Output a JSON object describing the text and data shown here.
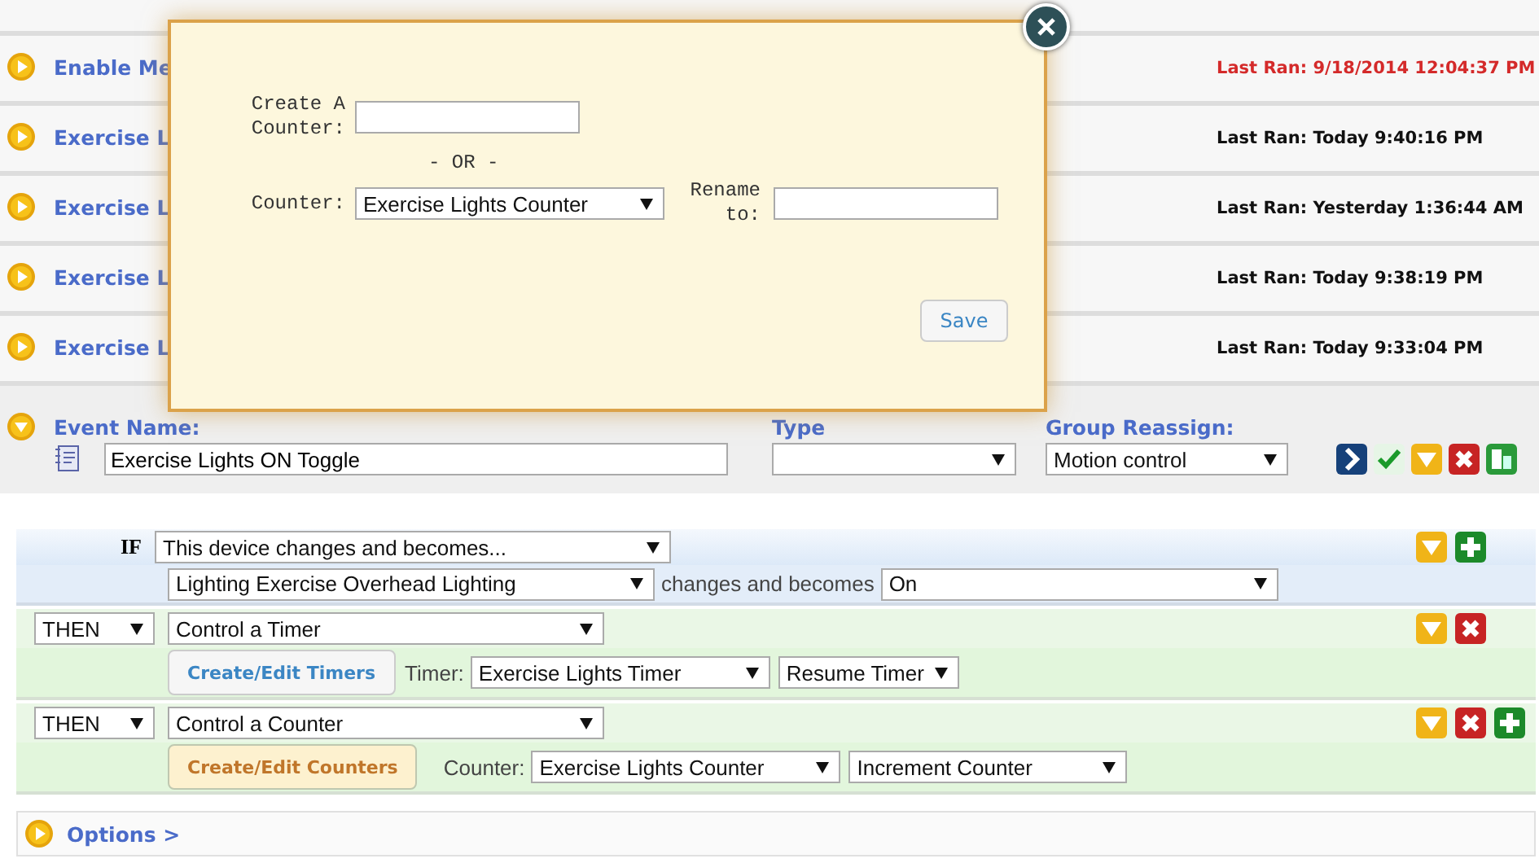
{
  "events": [
    {
      "title": "Enable Me",
      "last_ran": "Last Ran: 9/18/2014 12:04:37 PM",
      "color": "#d42a2a"
    },
    {
      "title": "Exercise L",
      "last_ran": "Last Ran: Today 9:40:16 PM",
      "color": "#111111"
    },
    {
      "title": "Exercise L",
      "last_ran": "Last Ran: Yesterday 1:36:44 AM",
      "color": "#111111"
    },
    {
      "title": "Exercise L",
      "last_ran": "Last Ran: Today 9:38:19 PM",
      "color": "#111111"
    },
    {
      "title": "Exercise L",
      "last_ran": "Last Ran: Today 9:33:04 PM",
      "color": "#111111"
    }
  ],
  "event_editor": {
    "name_label": "Event Name:",
    "name_value": "Exercise Lights ON Toggle",
    "type_label": "Type",
    "group_label": "Group Reassign:",
    "group_value": "Motion control",
    "tools": [
      {
        "kind": "go"
      },
      {
        "kind": "check"
      },
      {
        "kind": "down"
      },
      {
        "kind": "delete"
      },
      {
        "kind": "copy"
      }
    ]
  },
  "rules": [
    {
      "kind": "condition",
      "keyword": "IF",
      "select": "This device changes and becomes...",
      "device": "Lighting Exercise Overhead Lighting",
      "joiner": "changes and becomes",
      "state": "On",
      "tools": [
        {
          "kind": "down"
        },
        {
          "kind": "add"
        }
      ]
    },
    {
      "kind": "action",
      "keyword": "THEN",
      "select": "Control a Timer",
      "button": "Create/Edit Timers",
      "button_highlighted": false,
      "param_label": "Timer:",
      "param": "Exercise Lights Timer",
      "operation": "Resume Timer",
      "tools": [
        {
          "kind": "down"
        },
        {
          "kind": "delete"
        }
      ]
    },
    {
      "kind": "action",
      "keyword": "THEN",
      "select": "Control a Counter",
      "button": "Create/Edit Counters",
      "button_highlighted": true,
      "param_label": "Counter:",
      "param": "Exercise Lights Counter",
      "operation": "Increment Counter",
      "tools": [
        {
          "kind": "down"
        },
        {
          "kind": "delete"
        },
        {
          "kind": "add"
        }
      ]
    }
  ],
  "options": "Options >",
  "modal": {
    "create_label": "Create A Counter:",
    "or": "- OR -",
    "counter_label": "Counter:",
    "counter_value": "Exercise Lights Counter",
    "rename_label": "Rename to:",
    "save": "Save"
  }
}
